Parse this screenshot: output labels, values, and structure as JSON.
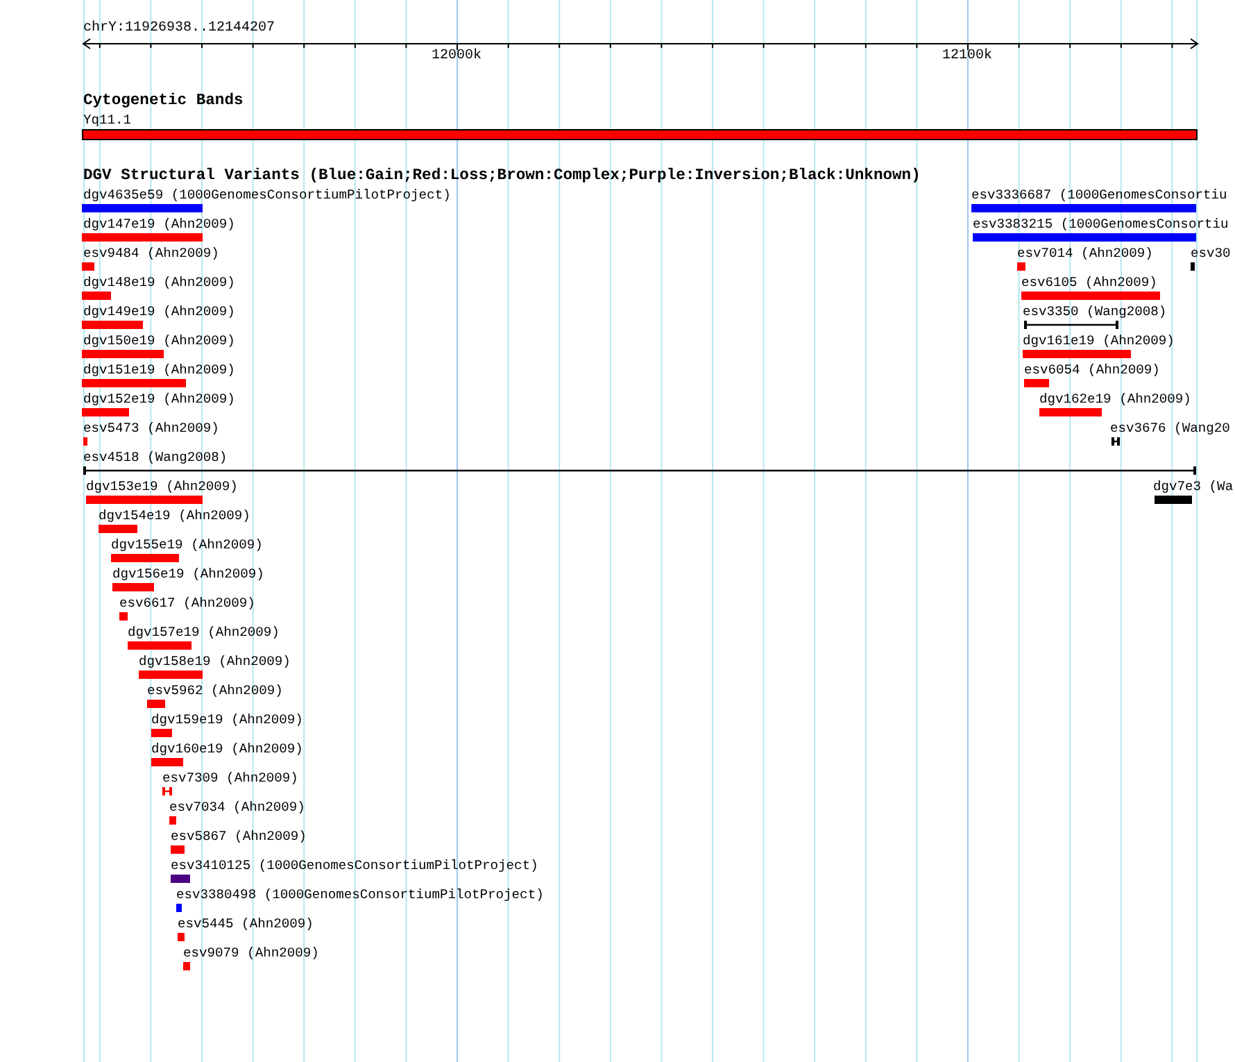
{
  "ruler": {
    "range": "chrY:11926938..12144207",
    "tick_labels": [
      "12000k",
      "12100k"
    ]
  },
  "tracks": [
    {
      "title": "Cytogenetic Bands",
      "features": [
        {
          "label": "Yq11.1",
          "kind": "band",
          "color": "#ff0000"
        }
      ]
    },
    {
      "title": "DGV Structural Variants (Blue:Gain;Red:Loss;Brown:Complex;Purple:Inversion;Black:Unknown)",
      "features": [
        {
          "label": "dgv4635e59 (1000GenomesConsortiumPilotProject)",
          "kind": "bar",
          "color": "#0000ff"
        },
        {
          "label": "esv3336687 (1000GenomesConsortiu",
          "kind": "bar",
          "color": "#0000ff"
        },
        {
          "label": "dgv147e19 (Ahn2009)",
          "kind": "bar",
          "color": "#ff0000"
        },
        {
          "label": "esv3383215 (1000GenomesConsortiu",
          "kind": "bar",
          "color": "#0000ff"
        },
        {
          "label": "esv9484 (Ahn2009)",
          "kind": "bar",
          "color": "#ff0000"
        },
        {
          "label": "esv7014 (Ahn2009)",
          "kind": "bar",
          "color": "#ff0000"
        },
        {
          "label": "esv30",
          "kind": "span",
          "color": "#000000"
        },
        {
          "label": "dgv148e19 (Ahn2009)",
          "kind": "bar",
          "color": "#ff0000"
        },
        {
          "label": "esv6105 (Ahn2009)",
          "kind": "bar",
          "color": "#ff0000"
        },
        {
          "label": "dgv149e19 (Ahn2009)",
          "kind": "bar",
          "color": "#ff0000"
        },
        {
          "label": "esv3350 (Wang2008)",
          "kind": "span",
          "color": "#000000"
        },
        {
          "label": "dgv150e19 (Ahn2009)",
          "kind": "bar",
          "color": "#ff0000"
        },
        {
          "label": "dgv161e19 (Ahn2009)",
          "kind": "bar",
          "color": "#ff0000"
        },
        {
          "label": "dgv151e19 (Ahn2009)",
          "kind": "bar",
          "color": "#ff0000"
        },
        {
          "label": "esv6054 (Ahn2009)",
          "kind": "bar",
          "color": "#ff0000"
        },
        {
          "label": "dgv152e19 (Ahn2009)",
          "kind": "bar",
          "color": "#ff0000"
        },
        {
          "label": "dgv162e19 (Ahn2009)",
          "kind": "bar",
          "color": "#ff0000"
        },
        {
          "label": "esv5473 (Ahn2009)",
          "kind": "bar",
          "color": "#ff0000"
        },
        {
          "label": "esv3676 (Wang20",
          "kind": "span",
          "color": "#000000"
        },
        {
          "label": "esv4518 (Wang2008)",
          "kind": "span",
          "color": "#000000"
        },
        {
          "label": "dgv153e19 (Ahn2009)",
          "kind": "bar",
          "color": "#ff0000"
        },
        {
          "label": "dgv7e3 (Wa",
          "kind": "bar",
          "color": "#000000"
        },
        {
          "label": "dgv154e19 (Ahn2009)",
          "kind": "bar",
          "color": "#ff0000"
        },
        {
          "label": "dgv155e19 (Ahn2009)",
          "kind": "bar",
          "color": "#ff0000"
        },
        {
          "label": "dgv156e19 (Ahn2009)",
          "kind": "bar",
          "color": "#ff0000"
        },
        {
          "label": "esv6617 (Ahn2009)",
          "kind": "bar",
          "color": "#ff0000"
        },
        {
          "label": "dgv157e19 (Ahn2009)",
          "kind": "bar",
          "color": "#ff0000"
        },
        {
          "label": "dgv158e19 (Ahn2009)",
          "kind": "bar",
          "color": "#ff0000"
        },
        {
          "label": "esv5962 (Ahn2009)",
          "kind": "bar",
          "color": "#ff0000"
        },
        {
          "label": "dgv159e19 (Ahn2009)",
          "kind": "bar",
          "color": "#ff0000"
        },
        {
          "label": "dgv160e19 (Ahn2009)",
          "kind": "bar",
          "color": "#ff0000"
        },
        {
          "label": "esv7309 (Ahn2009)",
          "kind": "span",
          "color": "#ff0000"
        },
        {
          "label": "esv7034 (Ahn2009)",
          "kind": "bar",
          "color": "#ff0000"
        },
        {
          "label": "esv5867 (Ahn2009)",
          "kind": "bar",
          "color": "#ff0000"
        },
        {
          "label": "esv3410125 (1000GenomesConsortiumPilotProject)",
          "kind": "bar",
          "color": "#4b0082"
        },
        {
          "label": "esv3380498 (1000GenomesConsortiumPilotProject)",
          "kind": "bar",
          "color": "#0000ff"
        },
        {
          "label": "esv5445 (Ahn2009)",
          "kind": "bar",
          "color": "#ff0000"
        },
        {
          "label": "esv9079 (Ahn2009)",
          "kind": "bar",
          "color": "#ff0000"
        }
      ]
    }
  ]
}
